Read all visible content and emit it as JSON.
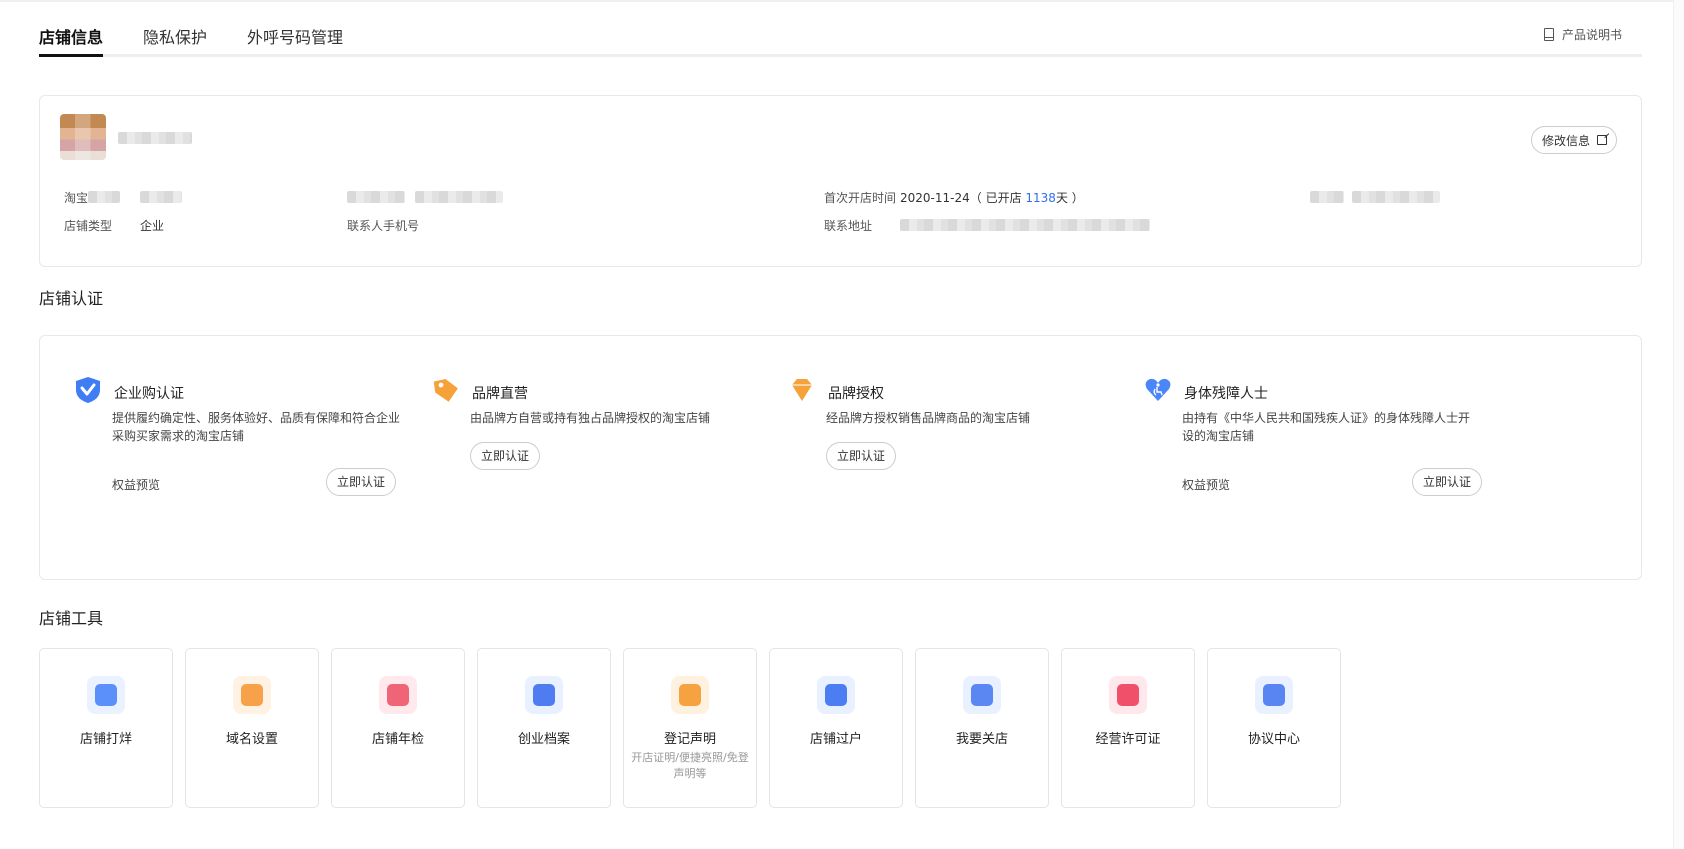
{
  "tabs": [
    {
      "label": "店铺信息",
      "active": true
    },
    {
      "label": "隐私保护",
      "active": false
    },
    {
      "label": "外呼号码管理",
      "active": false
    }
  ],
  "manual_label": "产品说明书",
  "store_info": {
    "edit_label": "修改信息",
    "taobao_label_prefix": "淘宝",
    "store_type_label": "店铺类型",
    "store_type_value": "企业",
    "contact_phone_label": "联系人手机号",
    "first_open_label": "首次开店时间",
    "first_open_date": "2020-11-24",
    "opened_prefix": "（ 已开店 ",
    "opened_days": "1138",
    "opened_suffix": "天 ）",
    "address_label": "联系地址"
  },
  "certification": {
    "section_title": "店铺认证",
    "items": [
      {
        "icon": "enterprise-shield-icon",
        "title": "企业购认证",
        "desc": "提供履约确定性、服务体验好、品质有保障和符合企业采购买家需求的淘宝店铺",
        "benefit": "权益预览",
        "button": "立即认证",
        "color": "#3f7df5"
      },
      {
        "icon": "brand-tag-icon",
        "title": "品牌直营",
        "desc": "由品牌方自营或持有独占品牌授权的淘宝店铺",
        "benefit": "",
        "button": "立即认证",
        "color": "#f5a23a"
      },
      {
        "icon": "diamond-icon",
        "title": "品牌授权",
        "desc": "经品牌方授权销售品牌商品的淘宝店铺",
        "benefit": "",
        "button": "立即认证",
        "color": "#f5a23a"
      },
      {
        "icon": "accessibility-heart-icon",
        "title": "身体残障人士",
        "desc": "由持有《中华人民共和国残疾人证》的身体残障人士开设的淘宝店铺",
        "benefit": "权益预览",
        "button": "立即认证",
        "color": "#4a86f7"
      }
    ]
  },
  "tools": {
    "section_title": "店铺工具",
    "items": [
      {
        "label": "店铺打烊",
        "sub": "",
        "icon": "store-closed-icon",
        "bg": "#eaf1ff",
        "fg": "#5b8ff9"
      },
      {
        "label": "域名设置",
        "sub": "",
        "icon": "domain-icon",
        "bg": "#fff2e3",
        "fg": "#f7a14a"
      },
      {
        "label": "店铺年检",
        "sub": "",
        "icon": "inspection-shield-icon",
        "bg": "#ffe9ec",
        "fg": "#f06478"
      },
      {
        "label": "创业档案",
        "sub": "",
        "icon": "archive-icon",
        "bg": "#e9f0ff",
        "fg": "#4f7cf0"
      },
      {
        "label": "登记声明",
        "sub": "开店证明/便捷亮照/免登声明等",
        "icon": "registration-doc-icon",
        "bg": "#fff1e0",
        "fg": "#f7a240"
      },
      {
        "label": "店铺过户",
        "sub": "",
        "icon": "transfer-icon",
        "bg": "#e9f0ff",
        "fg": "#4d7df2"
      },
      {
        "label": "我要关店",
        "sub": "",
        "icon": "close-store-icon",
        "bg": "#e9f0ff",
        "fg": "#5b87f3"
      },
      {
        "label": "经营许可证",
        "sub": "",
        "icon": "license-folder-icon",
        "bg": "#ffe8ec",
        "fg": "#f0506a"
      },
      {
        "label": "协议中心",
        "sub": "",
        "icon": "agreement-icon",
        "bg": "#e9f0ff",
        "fg": "#5985f2"
      }
    ]
  }
}
